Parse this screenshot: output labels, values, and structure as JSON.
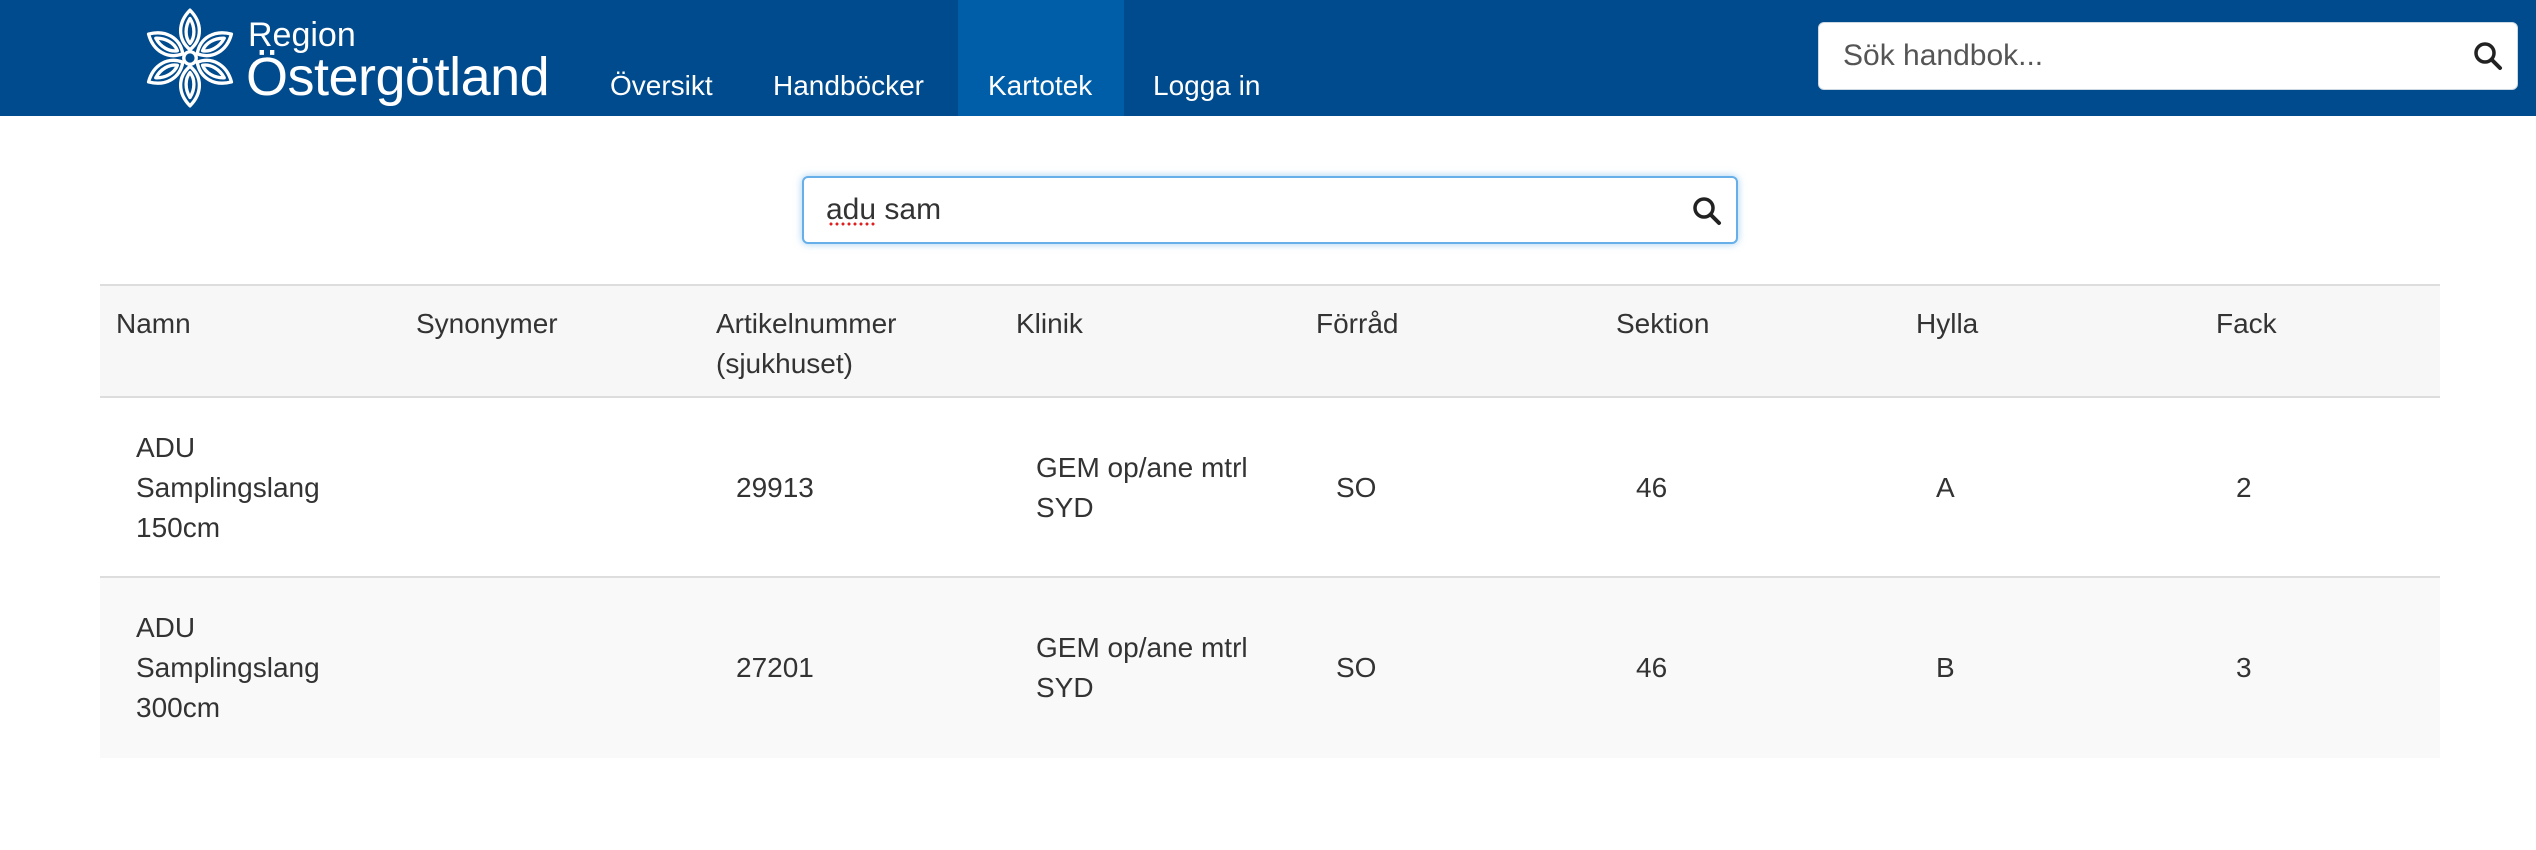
{
  "header": {
    "logo": {
      "line1": "Region",
      "line2": "Östergötland"
    },
    "nav": [
      {
        "label": "Översikt",
        "active": false
      },
      {
        "label": "Handböcker",
        "active": false
      },
      {
        "label": "Kartotek",
        "active": true
      },
      {
        "label": "Logga in",
        "active": false
      }
    ],
    "search": {
      "placeholder": "Sök handbok..."
    }
  },
  "search": {
    "value": "adu sam"
  },
  "table": {
    "headers": [
      "Namn",
      "Synonymer",
      "Artikelnummer (sjukhuset)",
      "Klinik",
      "Förråd",
      "Sektion",
      "Hylla",
      "Fack"
    ],
    "rows": [
      {
        "namn": "ADU Samplingslang 150cm",
        "synonymer": "",
        "artikelnummer": "29913",
        "klinik": "GEM op/ane mtrl SYD",
        "forrad": "SO",
        "sektion": "46",
        "hylla": "A",
        "fack": "2"
      },
      {
        "namn": "ADU Samplingslang 300cm",
        "synonymer": "",
        "artikelnummer": "27201",
        "klinik": "GEM op/ane mtrl SYD",
        "forrad": "SO",
        "sektion": "46",
        "hylla": "B",
        "fack": "3"
      }
    ]
  },
  "colors": {
    "header_bg": "#004b8d",
    "nav_active_bg": "#005ea8",
    "focus_border": "#66afe9",
    "table_header_bg": "#f7f7f7",
    "row_stripe_bg": "#f9f9f9"
  },
  "icons": {
    "search": "magnifier-icon",
    "logo": "flower-emblem-icon"
  }
}
